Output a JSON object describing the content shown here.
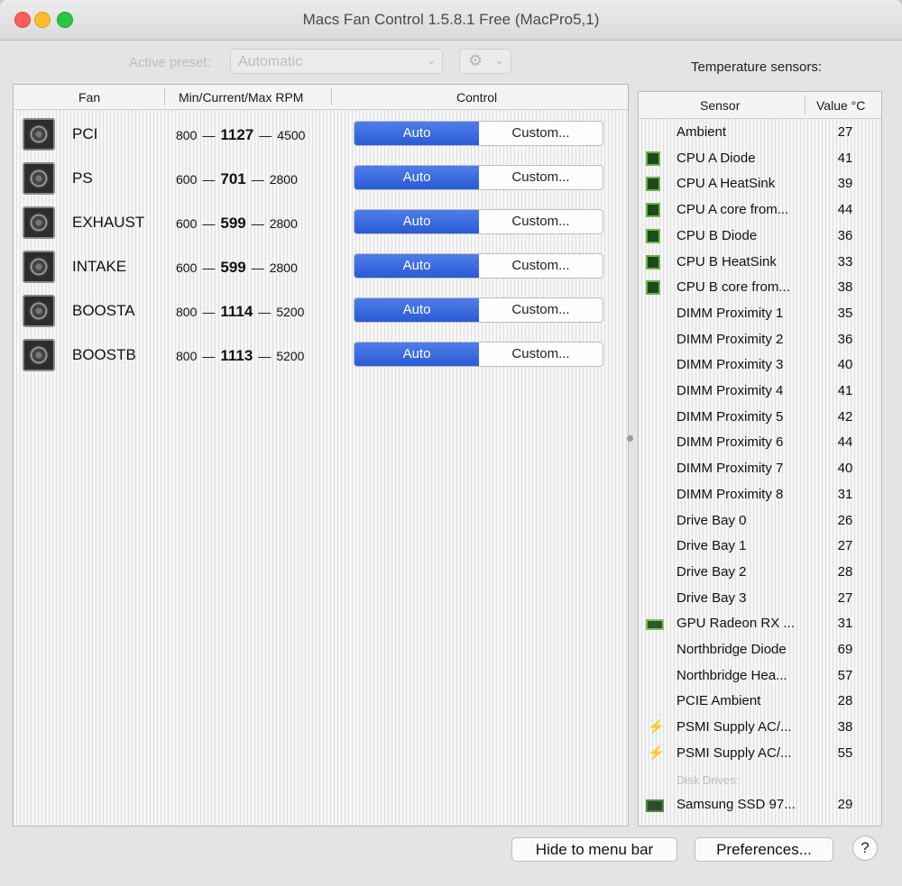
{
  "window": {
    "title": "Macs Fan Control 1.5.8.1 Free (MacPro5,1)"
  },
  "toolbar": {
    "active_preset_label": "Active preset:",
    "active_preset_value": "Automatic",
    "gear_icon": "gear-icon",
    "temperature_sensors_heading": "Temperature sensors:"
  },
  "fans": {
    "headers": {
      "fan": "Fan",
      "rpm": "Min/Current/Max RPM",
      "control": "Control"
    },
    "dash": "—",
    "rows": [
      {
        "name": "PCI",
        "min": "800",
        "current": "1127",
        "max": "4500",
        "auto_label": "Auto",
        "custom_label": "Custom..."
      },
      {
        "name": "PS",
        "min": "600",
        "current": "701",
        "max": "2800",
        "auto_label": "Auto",
        "custom_label": "Custom..."
      },
      {
        "name": "EXHAUST",
        "min": "600",
        "current": "599",
        "max": "2800",
        "auto_label": "Auto",
        "custom_label": "Custom..."
      },
      {
        "name": "INTAKE",
        "min": "600",
        "current": "599",
        "max": "2800",
        "auto_label": "Auto",
        "custom_label": "Custom..."
      },
      {
        "name": "BOOSTA",
        "min": "800",
        "current": "1114",
        "max": "5200",
        "auto_label": "Auto",
        "custom_label": "Custom..."
      },
      {
        "name": "BOOSTB",
        "min": "800",
        "current": "1113",
        "max": "5200",
        "auto_label": "Auto",
        "custom_label": "Custom..."
      }
    ]
  },
  "sensors": {
    "headers": {
      "sensor": "Sensor",
      "value": "Value °C"
    },
    "rows": [
      {
        "icon": "",
        "name": "Ambient",
        "value": "27"
      },
      {
        "icon": "chip",
        "name": "CPU A Diode",
        "value": "41"
      },
      {
        "icon": "chip",
        "name": "CPU A HeatSink",
        "value": "39"
      },
      {
        "icon": "chip",
        "name": "CPU A core from...",
        "value": "44"
      },
      {
        "icon": "chip",
        "name": "CPU B Diode",
        "value": "36"
      },
      {
        "icon": "chip",
        "name": "CPU B HeatSink",
        "value": "33"
      },
      {
        "icon": "chip",
        "name": "CPU B core from...",
        "value": "38"
      },
      {
        "icon": "",
        "name": "DIMM Proximity 1",
        "value": "35"
      },
      {
        "icon": "",
        "name": "DIMM Proximity 2",
        "value": "36"
      },
      {
        "icon": "",
        "name": "DIMM Proximity 3",
        "value": "40"
      },
      {
        "icon": "",
        "name": "DIMM Proximity 4",
        "value": "41"
      },
      {
        "icon": "",
        "name": "DIMM Proximity 5",
        "value": "42"
      },
      {
        "icon": "",
        "name": "DIMM Proximity 6",
        "value": "44"
      },
      {
        "icon": "",
        "name": "DIMM Proximity 7",
        "value": "40"
      },
      {
        "icon": "",
        "name": "DIMM Proximity 8",
        "value": "31"
      },
      {
        "icon": "",
        "name": "Drive Bay 0",
        "value": "26"
      },
      {
        "icon": "",
        "name": "Drive Bay 1",
        "value": "27"
      },
      {
        "icon": "",
        "name": "Drive Bay 2",
        "value": "28"
      },
      {
        "icon": "",
        "name": "Drive Bay 3",
        "value": "27"
      },
      {
        "icon": "gpu",
        "name": "GPU Radeon RX ...",
        "value": "31"
      },
      {
        "icon": "",
        "name": "Northbridge Diode",
        "value": "69"
      },
      {
        "icon": "",
        "name": "Northbridge Hea...",
        "value": "57"
      },
      {
        "icon": "",
        "name": "PCIE Ambient",
        "value": "28"
      },
      {
        "icon": "bolt",
        "name": "PSMI Supply AC/...",
        "value": "38"
      },
      {
        "icon": "bolt",
        "name": "PSMI Supply AC/...",
        "value": "55"
      }
    ],
    "disk_section_label": "Disk Drives:",
    "disk_rows": [
      {
        "icon": "ssd",
        "name": "Samsung SSD 97...",
        "value": "29"
      }
    ]
  },
  "footer": {
    "hide_label": "Hide to menu bar",
    "preferences_label": "Preferences...",
    "help_label": "?"
  }
}
